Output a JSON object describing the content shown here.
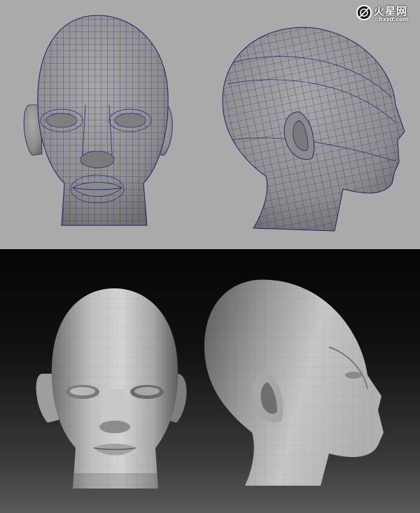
{
  "watermark": {
    "site_name": "火星网",
    "site_url": "hxsd.com",
    "emblem_icon": "hxsd-logo-emblem"
  },
  "panels": [
    {
      "name": "wireframe-render",
      "background": "#aaaaaa",
      "wire_color": "#22226e",
      "views": [
        "front",
        "side"
      ]
    },
    {
      "name": "shaded-render",
      "background": "#121212",
      "surface_color": "#bdbdbd",
      "views": [
        "front",
        "side"
      ]
    }
  ]
}
